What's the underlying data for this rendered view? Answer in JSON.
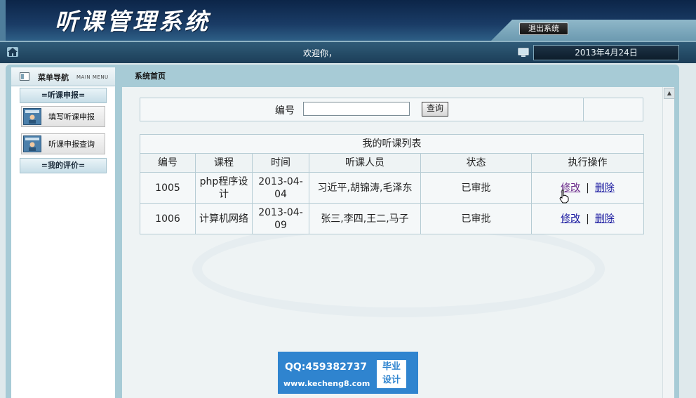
{
  "header": {
    "app_title": "听课管理系统",
    "logout_label": "退出系统"
  },
  "welcome_bar": {
    "welcome_text": "欢迎你，",
    "date": "2013年4月24日"
  },
  "sidebar": {
    "title": "菜单导航",
    "subtitle": "MAIN MENU",
    "sections": [
      {
        "label": "=听课申报=",
        "items": [
          {
            "label": "填写听课申报"
          },
          {
            "label": "听课申报查询"
          }
        ]
      },
      {
        "label": "=我的评价="
      }
    ]
  },
  "main": {
    "breadcrumb": "系统首页",
    "search": {
      "label": "编号",
      "value": "",
      "button": "查询"
    },
    "table": {
      "caption": "我的听课列表",
      "columns": [
        "编号",
        "课程",
        "时间",
        "听课人员",
        "状态",
        "执行操作"
      ],
      "rows": [
        {
          "id": "1005",
          "course": "php程序设计",
          "time": "2013-04-04",
          "people": "习近平,胡锦涛,毛泽东",
          "status": "已审批",
          "edit": "修改",
          "delete": "删除"
        },
        {
          "id": "1006",
          "course": "计算机网络",
          "time": "2013-04-09",
          "people": "张三,李四,王二,马子",
          "status": "已审批",
          "edit": "修改",
          "delete": "删除"
        }
      ],
      "op_separator": "|"
    }
  },
  "promo": {
    "qq": "QQ:459382737",
    "url": "www.kecheng8.com",
    "badge_line1": "毕业",
    "badge_line2": "设计"
  },
  "colors": {
    "header_bg": "#1a3c66",
    "frame_bg": "#a7cbd6",
    "status_green": "#11740f",
    "link_blue": "#1a1aa0",
    "promo_blue": "#2f84cf"
  }
}
